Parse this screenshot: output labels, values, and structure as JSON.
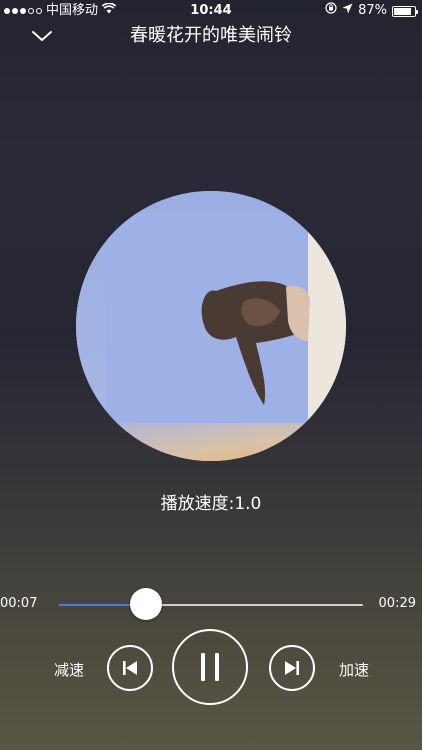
{
  "status_bar": {
    "signal_strength": 3,
    "signal_max": 5,
    "carrier": "中国移动",
    "time": "10:44",
    "battery_percent": "87%",
    "battery_level": 0.87
  },
  "header": {
    "title": "春暖花开的唯美闹铃"
  },
  "player": {
    "speed_label": "播放速度:1.0",
    "current_time": "00:07",
    "total_time": "00:29",
    "progress": 0.287,
    "colors": {
      "progress": "#3d7df0",
      "track": "#cfcfd2"
    }
  },
  "controls": {
    "slow_label": "减速",
    "fast_label": "加速",
    "prev_icon": "skip-previous-icon",
    "play_icon": "pause-icon",
    "next_icon": "skip-next-icon"
  }
}
